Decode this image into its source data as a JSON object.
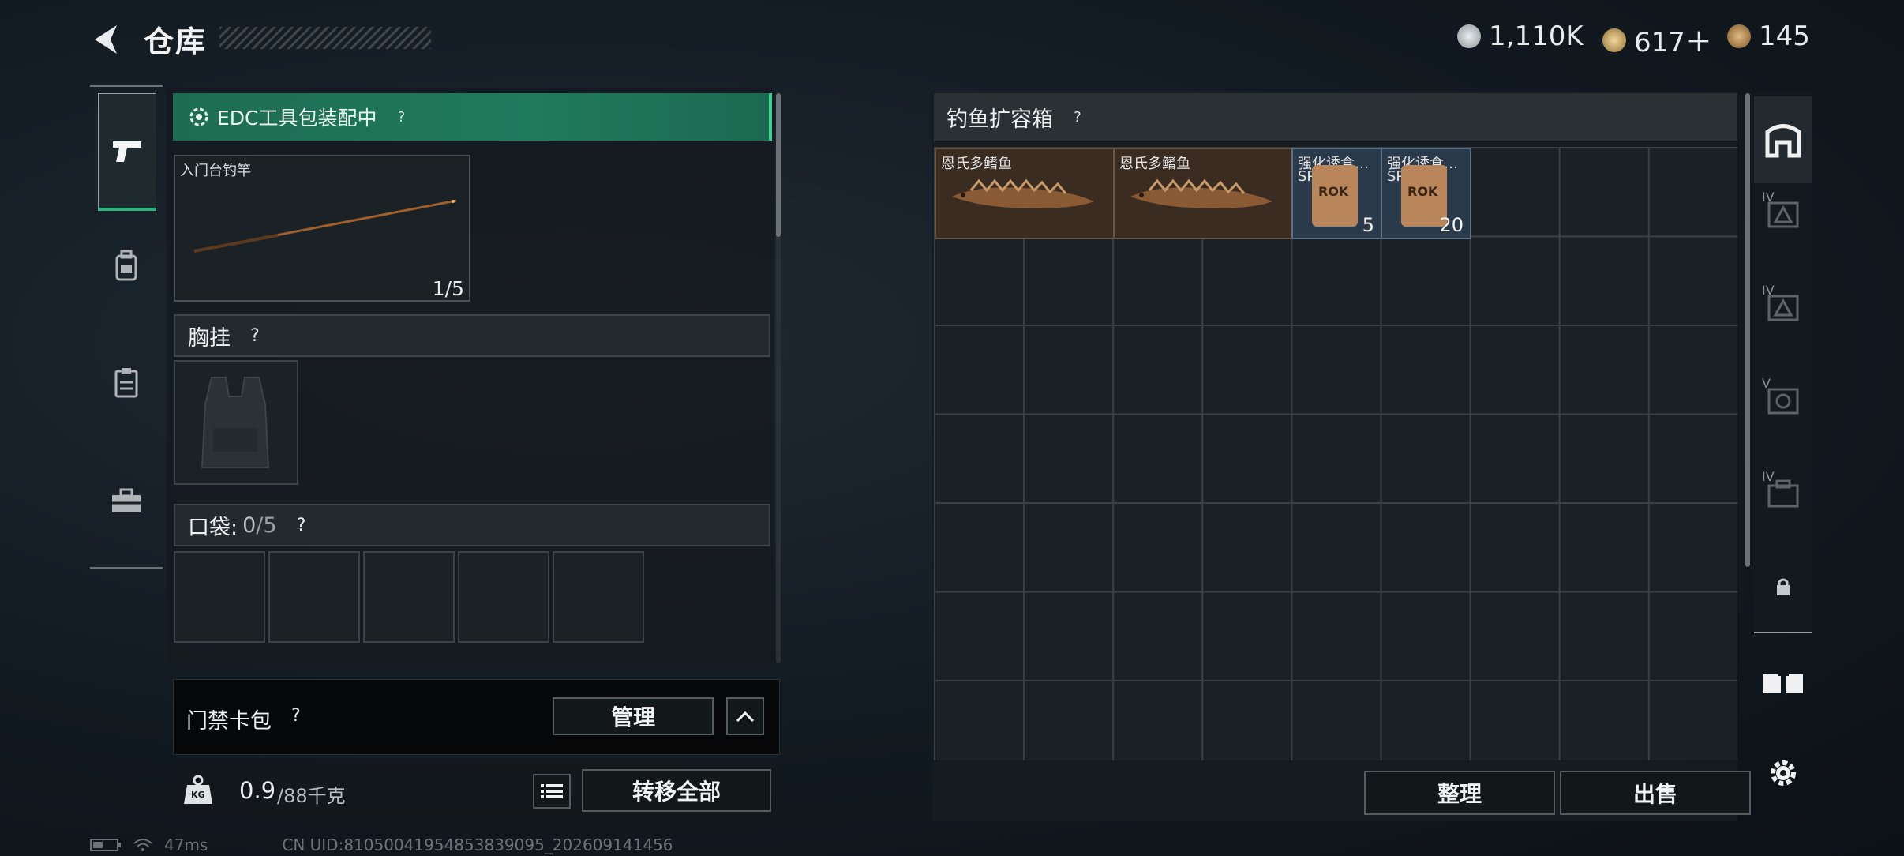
{
  "header": {
    "title": "仓库",
    "currencies": [
      {
        "icon": "silver-coin-icon",
        "value": "1,110K",
        "color": "#bfc5c8"
      },
      {
        "icon": "gold-triangle-coin-icon",
        "value": "617＋",
        "color": "#c9a96b"
      },
      {
        "icon": "bronze-coin-icon",
        "value": "145",
        "color": "#b88d54"
      }
    ]
  },
  "left_rail": [
    {
      "icon": "pistol-icon",
      "active": true
    },
    {
      "icon": "backpack-icon",
      "active": false
    },
    {
      "icon": "clipboard-icon",
      "active": false
    },
    {
      "icon": "toolbox-icon",
      "active": false
    }
  ],
  "left_panel": {
    "edc_label": "EDC工具包装配中",
    "rod": {
      "name": "入门台钓竿",
      "count": "1/5"
    },
    "chest_rig_label": "胸挂",
    "pocket_label": "口袋:",
    "pocket_used": "0",
    "pocket_total": "/5",
    "keycard_label": "门禁卡包",
    "manage_label": "管理",
    "weight_value": "0.9",
    "weight_total": "/88千克",
    "weight_icon_text": "KG",
    "transfer_all_label": "转移全部"
  },
  "right_panel": {
    "title": "钓鱼扩容箱",
    "items": [
      {
        "name": "恩氏多鳍鱼",
        "type": "fish"
      },
      {
        "name": "恩氏多鳍鱼",
        "type": "fish"
      },
      {
        "name": "强化诱食…",
        "sub": "SP",
        "count": "5",
        "type": "bait",
        "pack_text": "ROK"
      },
      {
        "name": "强化诱食…",
        "sub": "SP",
        "count": "20",
        "type": "bait",
        "pack_text": "ROK"
      }
    ],
    "sort_label": "整理",
    "sell_label": "出售"
  },
  "right_rail": [
    {
      "icon": "storage-icon",
      "badge": ""
    },
    {
      "icon": "container-icon",
      "badge": "IV"
    },
    {
      "icon": "container-icon",
      "badge": "IV"
    },
    {
      "icon": "container-icon",
      "badge": "V"
    },
    {
      "icon": "container-icon",
      "badge": "IV"
    },
    {
      "icon": "lock-icon",
      "badge": ""
    },
    {
      "icon": "transfer-icon",
      "badge": ""
    },
    {
      "icon": "settings-gear-icon",
      "badge": ""
    }
  ],
  "status_bar": {
    "ping": "47ms",
    "uid": "CN UID:81050041954853839095_202609141456"
  }
}
